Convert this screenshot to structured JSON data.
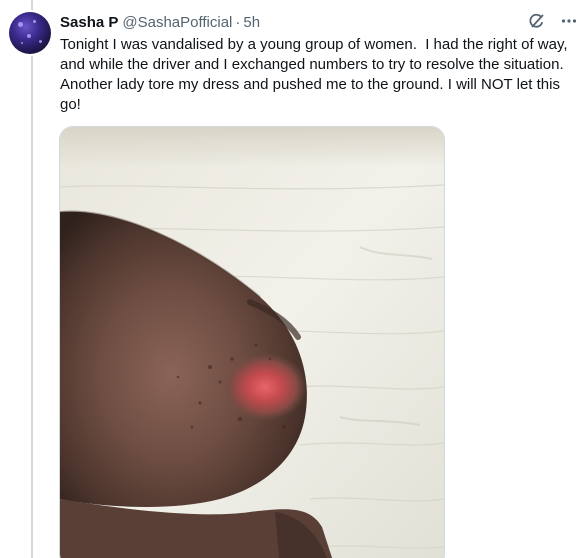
{
  "tweet": {
    "author_name": "Sasha P",
    "author_handle": "@SashaPofficial",
    "separator": "·",
    "time": "5h",
    "text": "Tonight I was vandalised by a young group of women.  I had the right of way, and while the driver and I exchanged numbers to try to resolve the situation. Another lady tore my dress and pushed me to the ground. I will NOT let this go!"
  },
  "icons": {
    "header_left": "grok-icon",
    "header_right": "more-icon"
  },
  "colors": {
    "text_primary": "#0f1419",
    "text_secondary": "#536471",
    "border": "#cfd9de"
  }
}
